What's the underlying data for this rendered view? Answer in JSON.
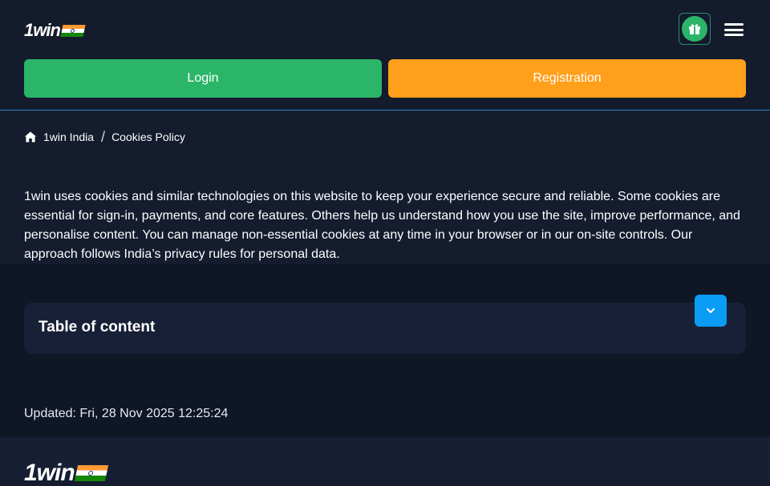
{
  "header": {
    "logo_text": "1win",
    "login_label": "Login",
    "registration_label": "Registration"
  },
  "breadcrumb": {
    "home_label": "1win India",
    "separator": "/",
    "current_label": "Cookies Policy"
  },
  "intro": {
    "text": "1win uses cookies and similar technologies on this website to keep your experience secure and reliable. Some cookies are essential for sign-in, payments, and core features. Others help us understand how you use the site, improve performance, and personalise content. You can manage non-essential cookies at any time in your browser or in our on-site controls. Our approach follows India’s privacy rules for personal data."
  },
  "toc": {
    "title": "Table of content"
  },
  "updated": {
    "text": "Updated: Fri, 28 Nov 2025 12:25:24"
  },
  "footer": {
    "logo_text": "1win"
  },
  "icons": {
    "logo_flag": "india-flag-icon",
    "gift": "gift-icon",
    "menu": "hamburger-menu-icon",
    "home": "home-icon",
    "toc_toggle": "chevron-down-icon"
  },
  "colors": {
    "background": "#141c2e",
    "login": "#2bb568",
    "registration": "#ff9f1a",
    "accent_blue": "#0a9bf5"
  }
}
